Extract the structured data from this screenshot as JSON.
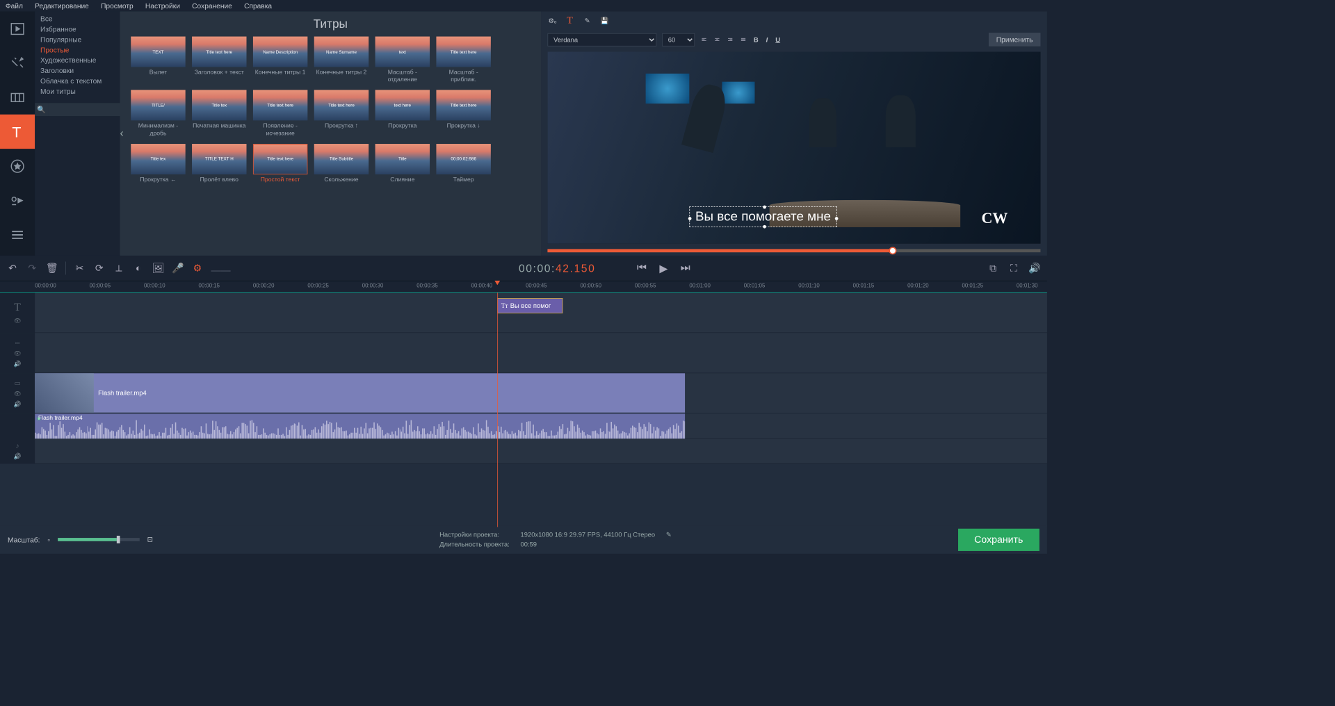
{
  "menu": [
    "Файл",
    "Редактирование",
    "Просмотр",
    "Настройки",
    "Сохранение",
    "Справка"
  ],
  "categories": [
    "Все",
    "Избранное",
    "Популярные",
    "Простые",
    "Художественные",
    "Заголовки",
    "Облачка с текстом",
    "Мои титры"
  ],
  "activeCategory": "Простые",
  "panelTitle": "Титры",
  "titles": [
    {
      "label": "Вылет",
      "thumb": "TEXT"
    },
    {
      "label": "Заголовок + текст",
      "thumb": "Title text here"
    },
    {
      "label": "Конечные титры 1",
      "thumb": "Name Description"
    },
    {
      "label": "Конечные титры 2",
      "thumb": "Name Surname"
    },
    {
      "label": "Масштаб - отдаление",
      "thumb": "text"
    },
    {
      "label": "Масштаб - приближ.",
      "thumb": "Title text here"
    },
    {
      "label": "Минимализм - дробь",
      "thumb": "TITLE/"
    },
    {
      "label": "Печатная машинка",
      "thumb": "Title tex"
    },
    {
      "label": "Появление - исчезание",
      "thumb": "Title text here"
    },
    {
      "label": "Прокрутка ↑",
      "thumb": "Title text here"
    },
    {
      "label": "Прокрутка",
      "thumb": "text here"
    },
    {
      "label": "Прокрутка ↓",
      "thumb": "Title text here"
    },
    {
      "label": "Прокрутка ←",
      "thumb": "Title tex"
    },
    {
      "label": "Пролёт влево",
      "thumb": "TITLE TEXT H"
    },
    {
      "label": "Простой текст",
      "thumb": "Title text here",
      "selected": true
    },
    {
      "label": "Скольжение",
      "thumb": "Title Subtitle"
    },
    {
      "label": "Слияние",
      "thumb": "Title"
    },
    {
      "label": "Таймер",
      "thumb": "00:00:02:986"
    }
  ],
  "font": {
    "family": "Verdana",
    "size": "60"
  },
  "applyLabel": "Применить",
  "overlayText": "Вы все помогаете мне",
  "network": "CW",
  "timecode": {
    "a": "00:00:",
    "b": "42.150"
  },
  "rulerTicks": [
    "00:00:00",
    "00:00:05",
    "00:00:10",
    "00:00:15",
    "00:00:20",
    "00:00:25",
    "00:00:30",
    "00:00:35",
    "00:00:40",
    "00:00:45",
    "00:00:50",
    "00:00:55",
    "00:01:00",
    "00:01:05",
    "00:01:10",
    "00:01:15",
    "00:01:20",
    "00:01:25",
    "00:01:30"
  ],
  "titleClip": "Вы все помог",
  "videoClip": "Flash trailer.mp4",
  "audioClip": "Flash trailer.mp4",
  "zoomLabel": "Масштаб:",
  "project": {
    "settingsLabel": "Настройки проекта:",
    "settings": "1920x1080 16:9 29.97 FPS, 44100 Гц Стерео",
    "durationLabel": "Длительность проекта:",
    "duration": "00:59"
  },
  "saveLabel": "Сохранить",
  "searchPlaceholder": ""
}
